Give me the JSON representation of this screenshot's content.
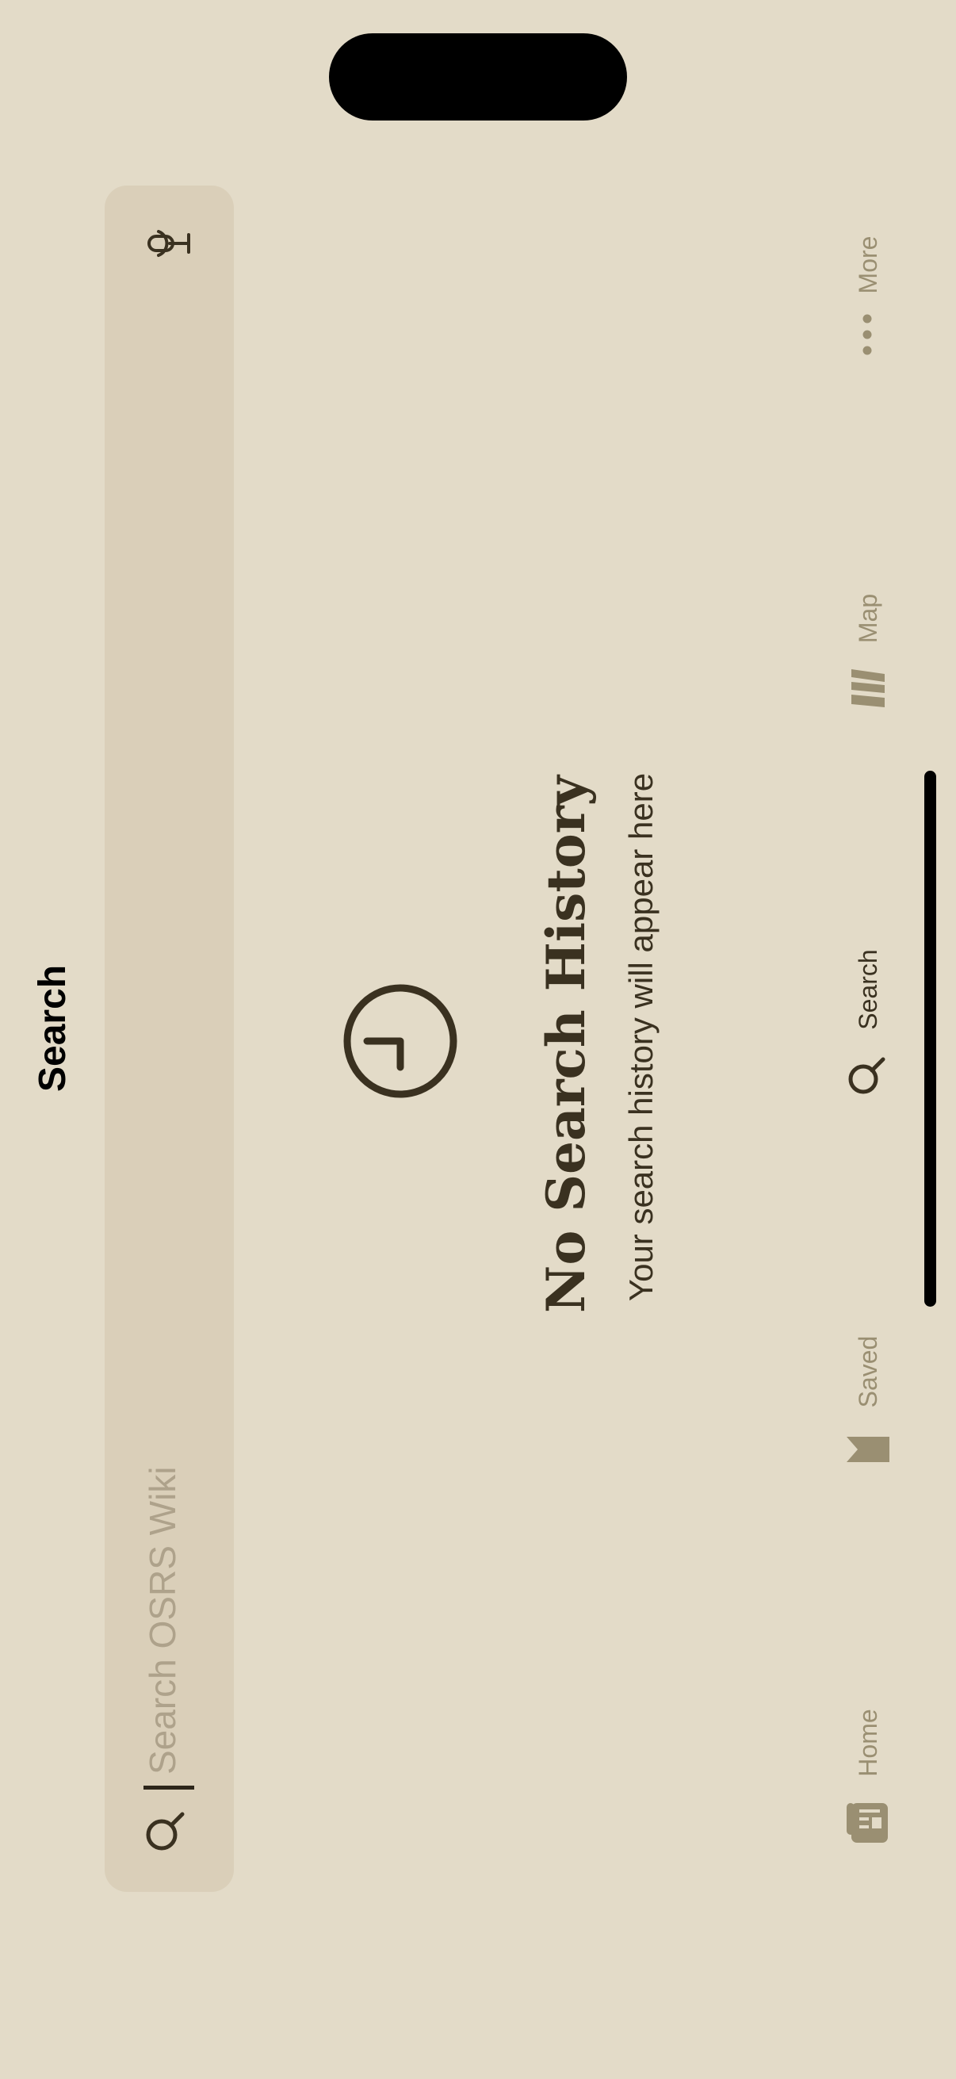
{
  "header": {
    "title": "Search"
  },
  "search": {
    "placeholder": "Search OSRS Wiki"
  },
  "empty_state": {
    "title": "No Search History",
    "subtitle": "Your search history will appear here"
  },
  "tabs": [
    {
      "label": "Home",
      "icon": "newspaper-icon",
      "active": false
    },
    {
      "label": "Saved",
      "icon": "bookmark-icon",
      "active": false
    },
    {
      "label": "Search",
      "icon": "search-icon",
      "active": true
    },
    {
      "label": "Map",
      "icon": "map-icon",
      "active": false
    },
    {
      "label": "More",
      "icon": "ellipsis-icon",
      "active": false
    }
  ],
  "colors": {
    "background": "#e3dbc8",
    "search_field": "#dacfb9",
    "text_dark": "#3a3120",
    "tab_inactive": "#9a8f72",
    "placeholder": "#aea28b"
  }
}
